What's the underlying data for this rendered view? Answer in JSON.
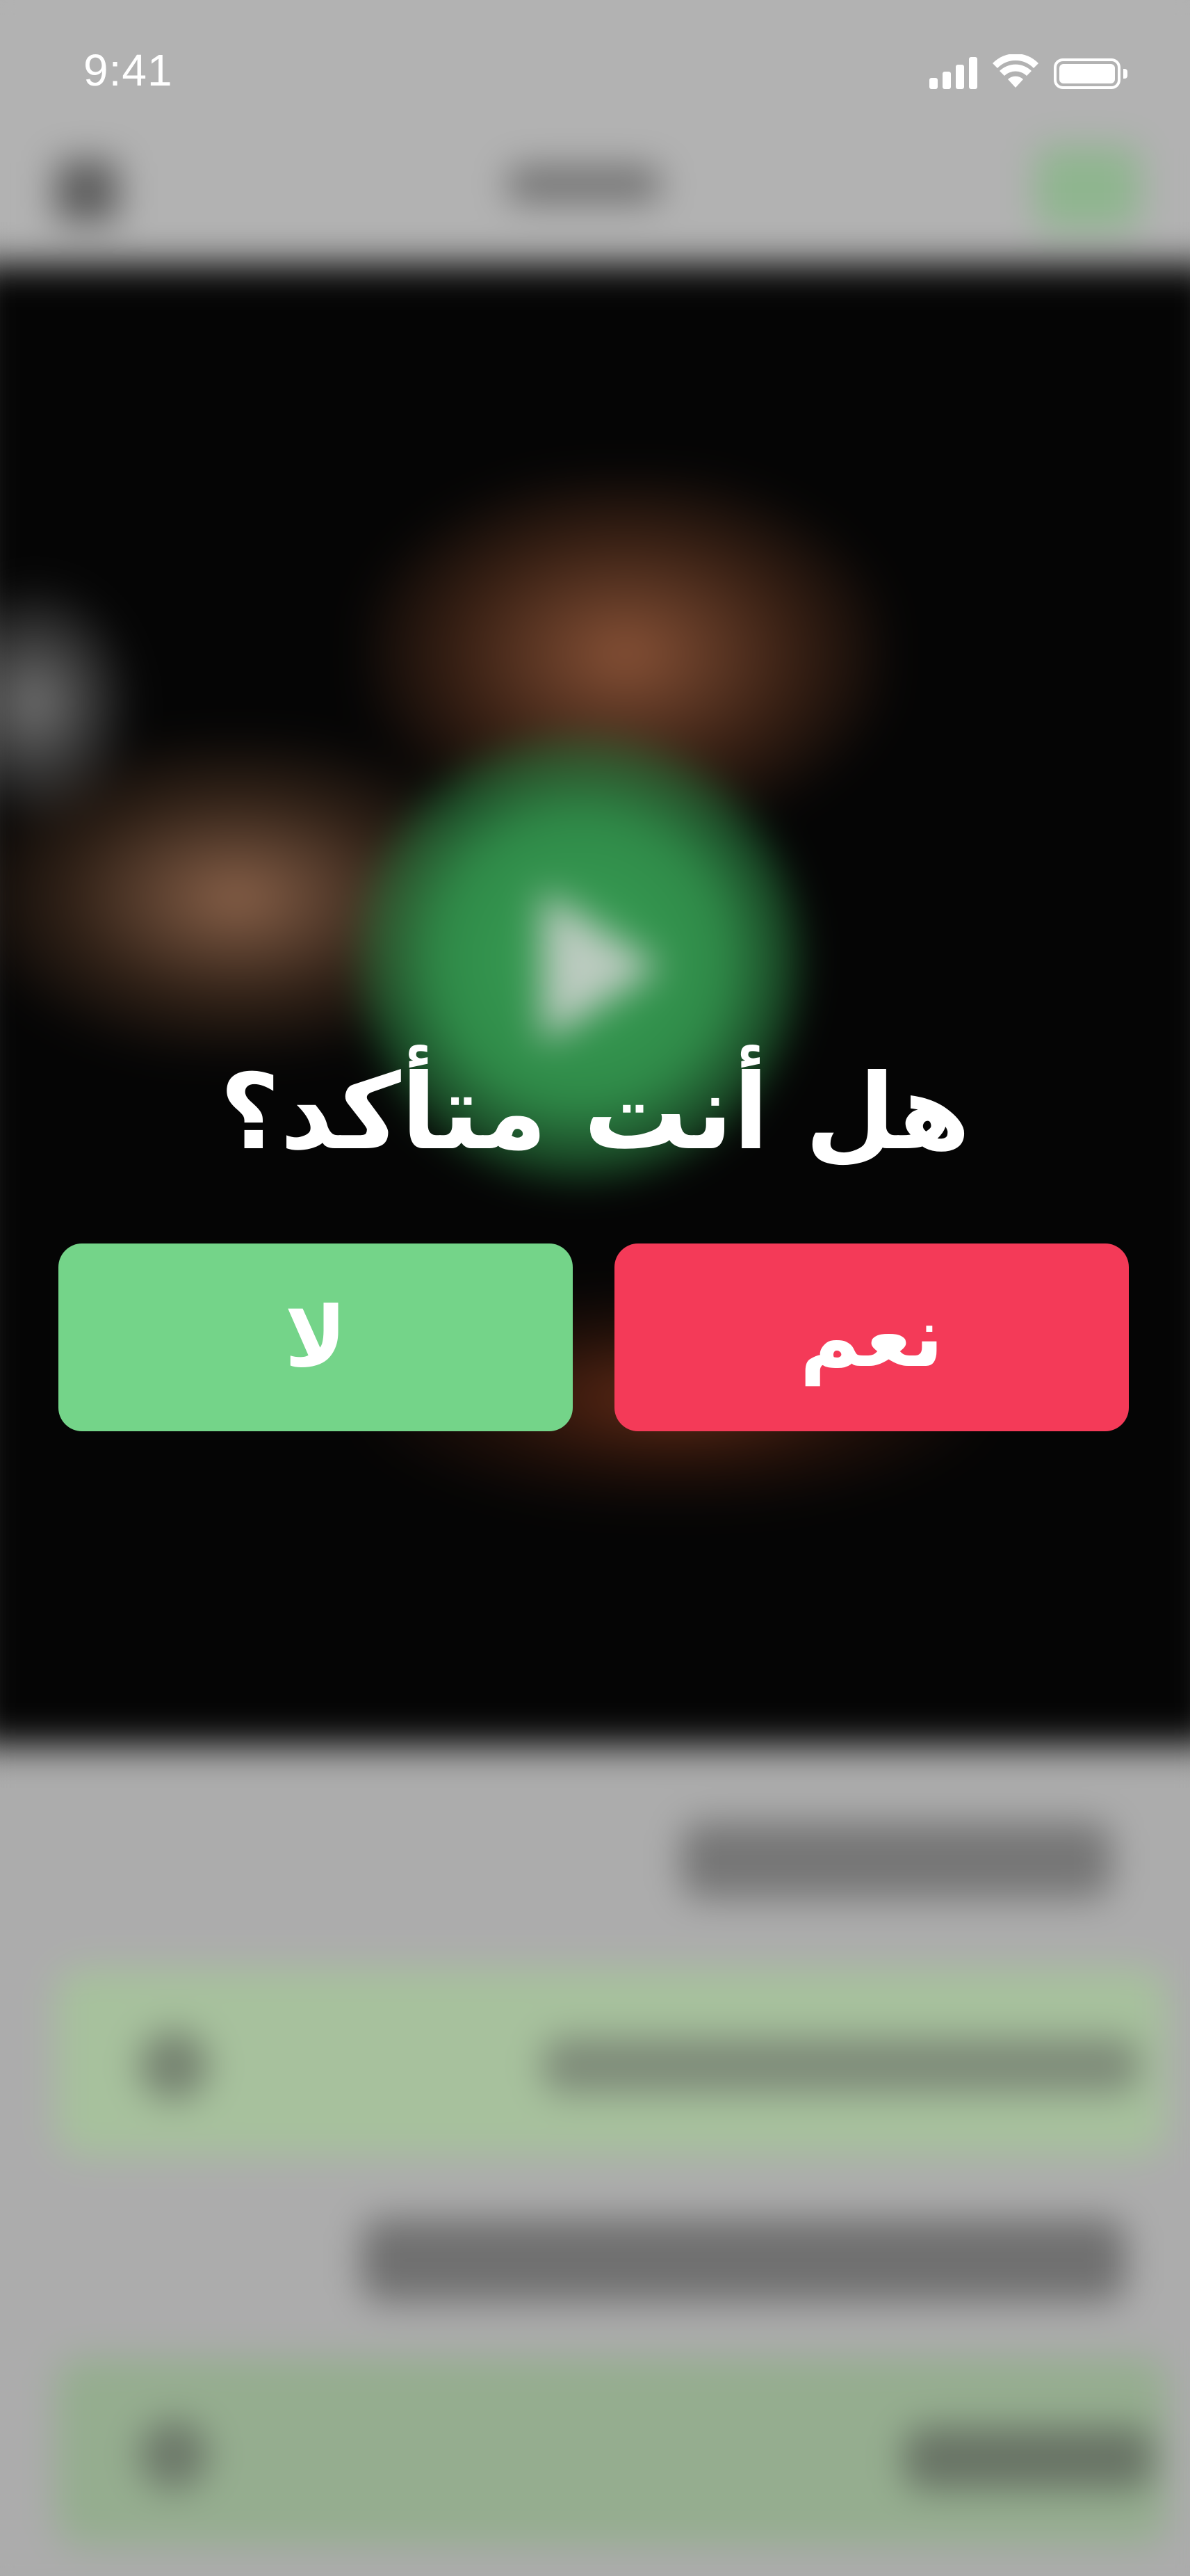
{
  "status_bar": {
    "time": "9:41",
    "icons": [
      "cellular-signal-icon",
      "wifi-icon",
      "battery-icon"
    ]
  },
  "dialog": {
    "title": "هل أنت متأكد؟",
    "no_label": "لا",
    "yes_label": "نعم"
  },
  "colors": {
    "no_button": "#74d489",
    "yes_button": "#f43a58",
    "overlay_text": "#ffffff",
    "play_button": "#2f8a48"
  }
}
